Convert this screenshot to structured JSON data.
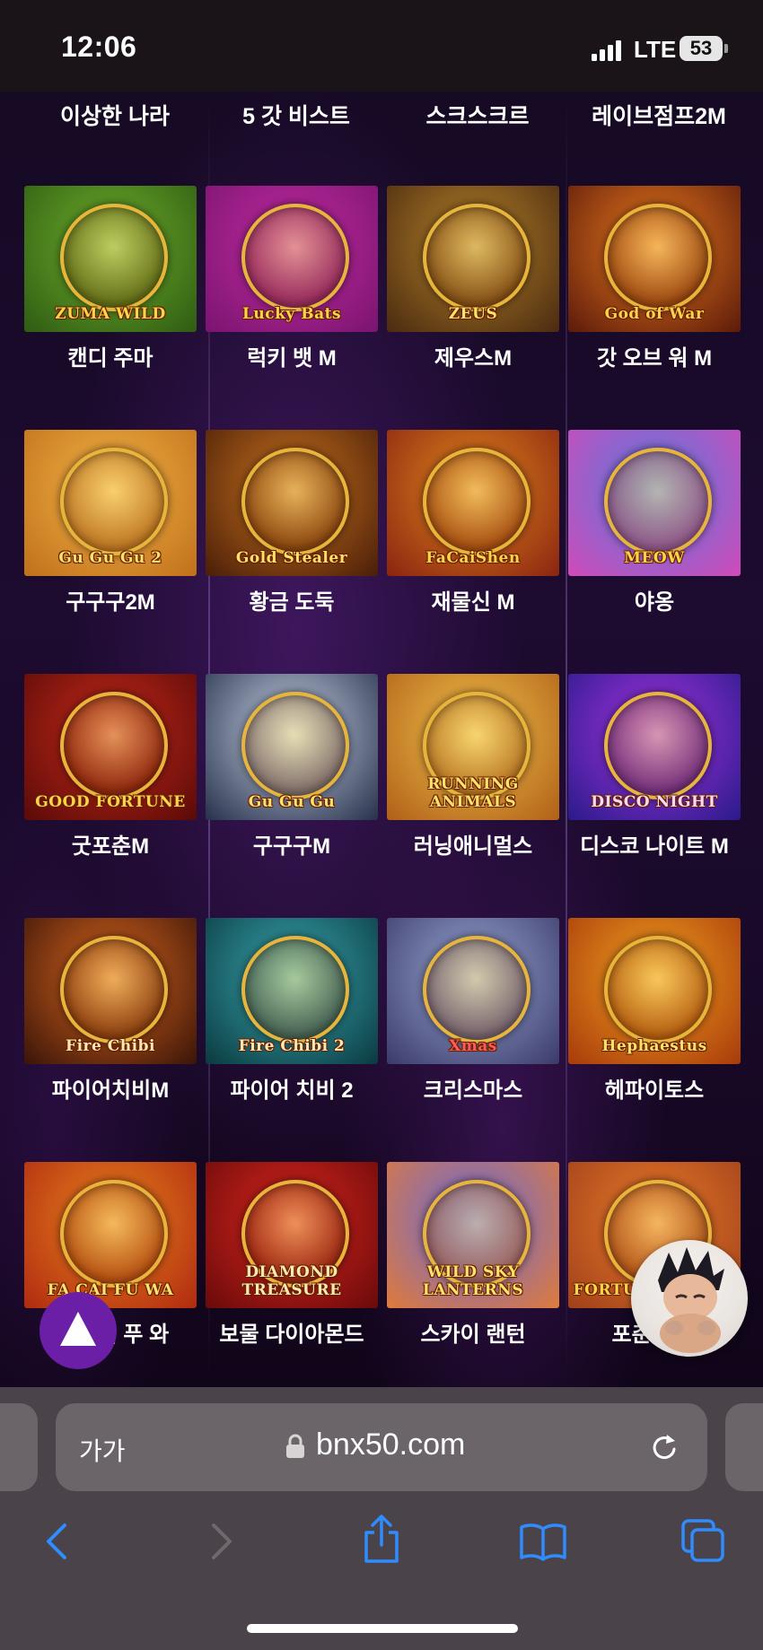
{
  "status_bar": {
    "time": "12:06",
    "network": "LTE",
    "battery": "53"
  },
  "top_row_labels": [
    "이상한 나라",
    "5 갓 비스트",
    "스크스크르",
    "레이브점프2M"
  ],
  "games": [
    {
      "label": "캔디 주마",
      "logo": "ZUMA WILD",
      "colors": [
        "#6fae2c",
        "#2e5b12"
      ],
      "logo_color": "#ffd44a"
    },
    {
      "label": "럭키 뱃 M",
      "logo": "Lucky Bats",
      "colors": [
        "#c02ba0",
        "#7a1470"
      ],
      "logo_color": "#ffd44a"
    },
    {
      "label": "제우스M",
      "logo": "ZEUS",
      "colors": [
        "#b5822a",
        "#4a2a10"
      ],
      "logo_color": "#ffe26a"
    },
    {
      "label": "갓 오브 워 M",
      "logo": "God of War",
      "colors": [
        "#e87a1e",
        "#5c1a0a"
      ],
      "logo_color": "#ffd44a"
    },
    {
      "label": "구구구2M",
      "logo": "Gu Gu Gu 2",
      "colors": [
        "#f2b347",
        "#c0701a"
      ],
      "logo_color": "#ffe26a"
    },
    {
      "label": "황금 도둑",
      "logo": "Gold Stealer",
      "colors": [
        "#c8721e",
        "#4a1e08"
      ],
      "logo_color": "#ffe26a"
    },
    {
      "label": "재물신 M",
      "logo": "FaCaiShen",
      "colors": [
        "#e0861e",
        "#8a2410"
      ],
      "logo_color": "#ffd44a"
    },
    {
      "label": "야옹",
      "logo": "MEOW",
      "colors": [
        "#5a7ae0",
        "#d04ab8"
      ],
      "logo_color": "#ffd44a"
    },
    {
      "label": "굿포춘M",
      "logo": "GOOD FORTUNE",
      "colors": [
        "#c42a1a",
        "#5a0a08"
      ],
      "logo_color": "#ffd44a"
    },
    {
      "label": "구구구M",
      "logo": "Gu Gu Gu",
      "colors": [
        "#c8d4e8",
        "#26304a"
      ],
      "logo_color": "#ffe26a"
    },
    {
      "label": "러닝애니멀스",
      "logo": "RUNNING ANIMALS",
      "colors": [
        "#f0c04a",
        "#b06018"
      ],
      "logo_color": "#ffe26a"
    },
    {
      "label": "디스코 나이트 M",
      "logo": "DISCO NIGHT",
      "colors": [
        "#a434e0",
        "#2a1a8a"
      ],
      "logo_color": "#ffd8f4"
    },
    {
      "label": "파이어치비M",
      "logo": "Fire Chibi",
      "colors": [
        "#d8661e",
        "#3a1408"
      ],
      "logo_color": "#ffe9b0"
    },
    {
      "label": "파이어 치비 2",
      "logo": "Fire Chibi 2",
      "colors": [
        "#3aa6b0",
        "#0a3a40"
      ],
      "logo_color": "#ffe9b0"
    },
    {
      "label": "크리스마스",
      "logo": "Xmas",
      "colors": [
        "#9aa8d4",
        "#3a3a6a"
      ],
      "logo_color": "#ff5a5a"
    },
    {
      "label": "헤파이토스",
      "logo": "Hephaestus",
      "colors": [
        "#f0a020",
        "#a83a0a"
      ],
      "logo_color": "#ffe26a"
    },
    {
      "label": "파 차이 푸 와",
      "logo": "FA CAI FU WA",
      "colors": [
        "#e8821e",
        "#b02a10"
      ],
      "logo_color": "#ffe26a"
    },
    {
      "label": "보물 다이아몬드",
      "logo": "DIAMOND TREASURE",
      "colors": [
        "#d8261e",
        "#6a0a0a"
      ],
      "logo_color": "#ffe9b0"
    },
    {
      "label": "스카이 랜턴",
      "logo": "WILD SKY LANTERNS",
      "colors": [
        "#6a6ad8",
        "#e07a3a"
      ],
      "logo_color": "#ffe26a"
    },
    {
      "label": "포춘 토템",
      "logo": "FORTUNE TOTEM",
      "colors": [
        "#e87a2a",
        "#a0401a"
      ],
      "logo_color": "#ffd44a"
    }
  ],
  "browser": {
    "text_size_label": "가가",
    "url": "bnx50.com"
  },
  "icons": {
    "scroll_top": "triangle-up-icon",
    "chat": "chat-avatar-icon",
    "lock": "lock-icon",
    "reload": "reload-icon",
    "back": "chevron-left-icon",
    "forward": "chevron-right-icon",
    "share": "share-icon",
    "bookmarks": "book-icon",
    "tabs": "tabs-icon"
  },
  "colors": {
    "accent_purple": "#6a1fa6",
    "safari_blue": "#2f8cff",
    "toolbar_bg": "#4a4349"
  }
}
